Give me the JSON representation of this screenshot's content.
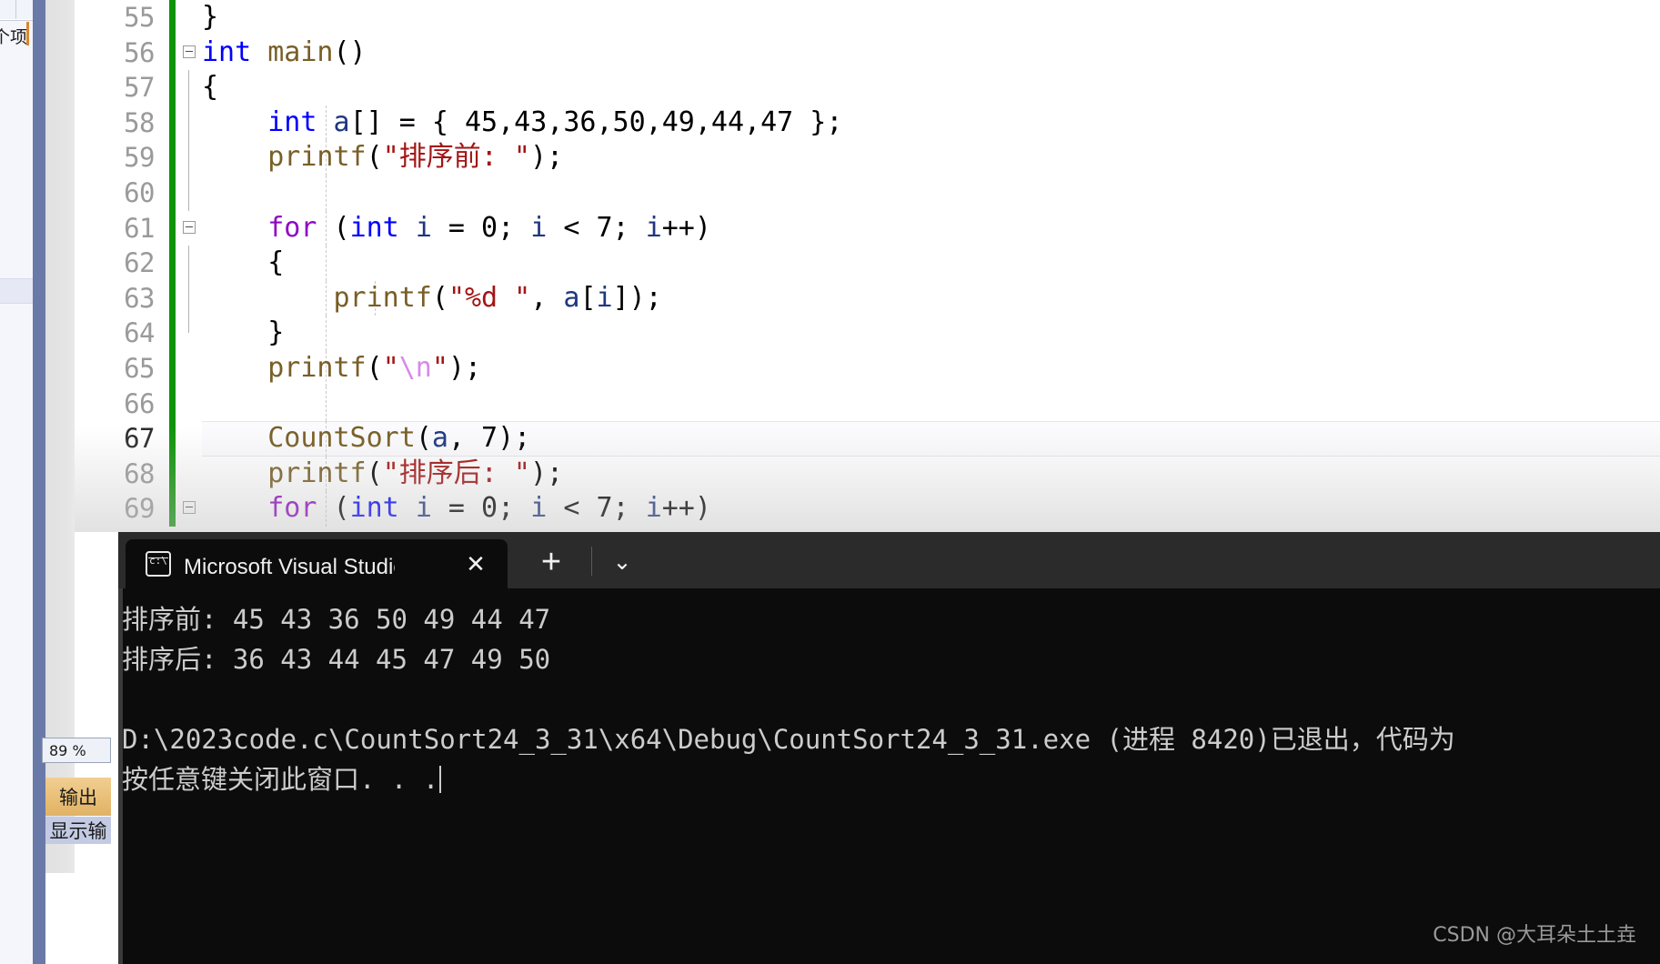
{
  "ide": {
    "left_panel": {
      "partial_label": "个项"
    },
    "zoom_level": "89 %",
    "bottom_tabs": [
      {
        "label": "输出"
      },
      {
        "label": "显示输"
      }
    ]
  },
  "editor": {
    "lines": [
      {
        "no": "55",
        "current": false,
        "fold": "none",
        "guides": [],
        "tokens": [
          {
            "t": "}",
            "c": "k-plain"
          }
        ],
        "indent": ""
      },
      {
        "no": "56",
        "current": false,
        "fold": "box",
        "guides": [],
        "tokens": [
          {
            "t": "int ",
            "c": "k-blue"
          },
          {
            "t": "main",
            "c": "k-fn"
          },
          {
            "t": "()",
            "c": "k-plain"
          }
        ],
        "indent": ""
      },
      {
        "no": "57",
        "current": false,
        "fold": "line",
        "guides": [],
        "tokens": [
          {
            "t": "{",
            "c": "k-plain"
          }
        ],
        "indent": ""
      },
      {
        "no": "58",
        "current": false,
        "fold": "line",
        "guides": [
          "ig2"
        ],
        "tokens": [
          {
            "t": "    ",
            "c": "k-plain"
          },
          {
            "t": "int ",
            "c": "k-blue"
          },
          {
            "t": "a",
            "c": "k-var"
          },
          {
            "t": "[] = { ",
            "c": "k-plain"
          },
          {
            "t": "45,43,36,50,49,44,47",
            "c": "k-plain"
          },
          {
            "t": " };",
            "c": "k-plain"
          }
        ],
        "indent": ""
      },
      {
        "no": "59",
        "current": false,
        "fold": "line",
        "guides": [
          "ig2"
        ],
        "tokens": [
          {
            "t": "    ",
            "c": "k-plain"
          },
          {
            "t": "printf",
            "c": "k-fn"
          },
          {
            "t": "(",
            "c": "k-plain"
          },
          {
            "t": "\"排序前: \"",
            "c": "k-str"
          },
          {
            "t": ");",
            "c": "k-plain"
          }
        ],
        "indent": ""
      },
      {
        "no": "60",
        "current": false,
        "fold": "line",
        "guides": [
          "ig2"
        ],
        "tokens": [
          {
            "t": "",
            "c": "k-plain"
          }
        ],
        "indent": ""
      },
      {
        "no": "61",
        "current": false,
        "fold": "box",
        "guides": [
          "ig2"
        ],
        "tokens": [
          {
            "t": "    ",
            "c": "k-plain"
          },
          {
            "t": "for ",
            "c": "k-purple"
          },
          {
            "t": "(",
            "c": "k-plain"
          },
          {
            "t": "int ",
            "c": "k-blue"
          },
          {
            "t": "i",
            "c": "k-var"
          },
          {
            "t": " = 0; ",
            "c": "k-plain"
          },
          {
            "t": "i",
            "c": "k-var"
          },
          {
            "t": " < 7; ",
            "c": "k-plain"
          },
          {
            "t": "i",
            "c": "k-var"
          },
          {
            "t": "++)",
            "c": "k-plain"
          }
        ],
        "indent": ""
      },
      {
        "no": "62",
        "current": false,
        "fold": "line",
        "guides": [
          "ig2"
        ],
        "tokens": [
          {
            "t": "    {",
            "c": "k-plain"
          }
        ],
        "indent": ""
      },
      {
        "no": "63",
        "current": false,
        "fold": "line",
        "guides": [
          "ig2",
          "ig3"
        ],
        "tokens": [
          {
            "t": "        ",
            "c": "k-plain"
          },
          {
            "t": "printf",
            "c": "k-fn"
          },
          {
            "t": "(",
            "c": "k-plain"
          },
          {
            "t": "\"%d \"",
            "c": "k-str"
          },
          {
            "t": ", ",
            "c": "k-plain"
          },
          {
            "t": "a",
            "c": "k-var"
          },
          {
            "t": "[",
            "c": "k-plain"
          },
          {
            "t": "i",
            "c": "k-var"
          },
          {
            "t": "]);",
            "c": "k-plain"
          }
        ],
        "indent": ""
      },
      {
        "no": "64",
        "current": false,
        "fold": "half",
        "guides": [
          "ig2"
        ],
        "tokens": [
          {
            "t": "    }",
            "c": "k-plain"
          }
        ],
        "indent": ""
      },
      {
        "no": "65",
        "current": false,
        "fold": "none",
        "guides": [
          "ig2"
        ],
        "tokens": [
          {
            "t": "    ",
            "c": "k-plain"
          },
          {
            "t": "printf",
            "c": "k-fn"
          },
          {
            "t": "(",
            "c": "k-plain"
          },
          {
            "t": "\"",
            "c": "k-str"
          },
          {
            "t": "\\n",
            "c": "k-esc"
          },
          {
            "t": "\"",
            "c": "k-str"
          },
          {
            "t": ");",
            "c": "k-plain"
          }
        ],
        "indent": ""
      },
      {
        "no": "66",
        "current": false,
        "fold": "none",
        "guides": [
          "ig2"
        ],
        "tokens": [
          {
            "t": "",
            "c": "k-plain"
          }
        ],
        "indent": ""
      },
      {
        "no": "67",
        "current": true,
        "fold": "none",
        "guides": [
          "ig2"
        ],
        "tokens": [
          {
            "t": "    ",
            "c": "k-plain"
          },
          {
            "t": "CountSort",
            "c": "k-fn"
          },
          {
            "t": "(",
            "c": "k-plain"
          },
          {
            "t": "a",
            "c": "k-var"
          },
          {
            "t": ", 7);",
            "c": "k-plain"
          }
        ],
        "indent": ""
      },
      {
        "no": "68",
        "current": false,
        "fold": "none",
        "guides": [
          "ig2"
        ],
        "tokens": [
          {
            "t": "    ",
            "c": "k-plain"
          },
          {
            "t": "printf",
            "c": "k-fn"
          },
          {
            "t": "(",
            "c": "k-plain"
          },
          {
            "t": "\"排序后: \"",
            "c": "k-str"
          },
          {
            "t": ");",
            "c": "k-plain"
          }
        ],
        "indent": ""
      },
      {
        "no": "69",
        "current": false,
        "fold": "box",
        "guides": [
          "ig2"
        ],
        "tokens": [
          {
            "t": "    ",
            "c": "k-plain"
          },
          {
            "t": "for ",
            "c": "k-purple"
          },
          {
            "t": "(",
            "c": "k-plain"
          },
          {
            "t": "int ",
            "c": "k-blue"
          },
          {
            "t": "i",
            "c": "k-var"
          },
          {
            "t": " = 0; ",
            "c": "k-plain"
          },
          {
            "t": "i",
            "c": "k-var"
          },
          {
            "t": " < 7; ",
            "c": "k-plain"
          },
          {
            "t": "i",
            "c": "k-var"
          },
          {
            "t": "++)",
            "c": "k-plain"
          }
        ],
        "indent": ""
      }
    ]
  },
  "console": {
    "tab_title": "Microsoft Visual Studio 调试挡",
    "tab_icon": "cmd-prompt-icon",
    "close_label": "✕",
    "new_tab_label": "+",
    "dropdown_label": "⌄",
    "lines": [
      "排序前: 45 43 36 50 49 44 47",
      "排序后: 36 43 44 45 47 49 50",
      "",
      "D:\\2023code.c\\CountSort24_3_31\\x64\\Debug\\CountSort24_3_31.exe (进程 8420)已退出，代码为",
      "按任意键关闭此窗口. . ."
    ],
    "watermark": "CSDN @大耳朵土土垚"
  },
  "colors": {
    "splitter": "#6a7aa8",
    "console_bg": "#0c0c0c",
    "console_titlebar": "#2b2b2b",
    "changed_line_marker": "#0f9409",
    "output_tab": "#e8bf76",
    "keyword": "#0000ff",
    "control_keyword": "#8f08c4",
    "string": "#a31515",
    "escape": "#d68ae8",
    "function": "#795e26",
    "variable": "#1f377f"
  }
}
